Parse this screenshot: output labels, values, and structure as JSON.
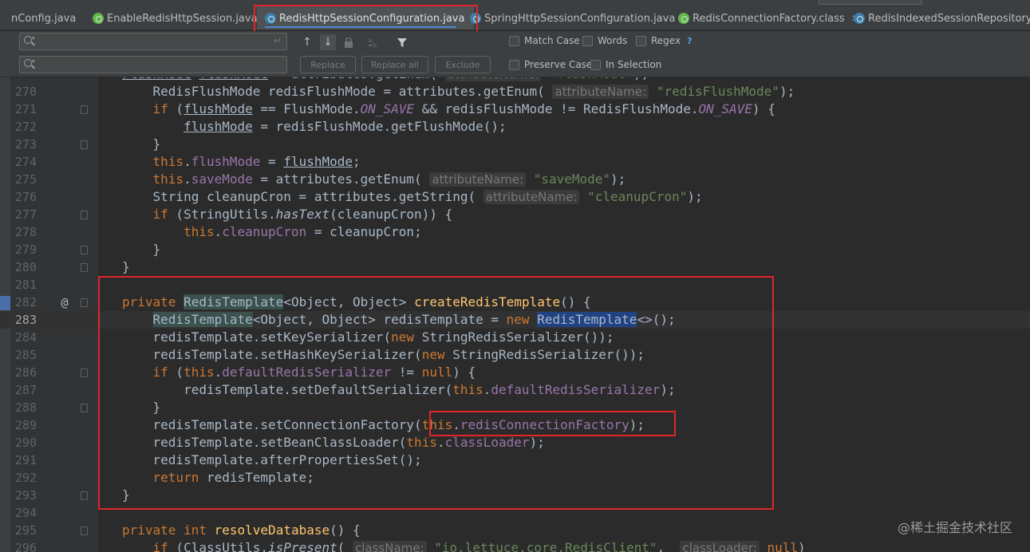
{
  "tabs": [
    {
      "label": "nConfig.java",
      "icon": "class-icon",
      "closable": false
    },
    {
      "label": "EnableRedisHttpSession.java",
      "icon": "annotation-icon",
      "closable": true
    },
    {
      "label": "RedisHttpSessionConfiguration.java",
      "icon": "class-icon",
      "closable": true,
      "active": true
    },
    {
      "label": "SpringHttpSessionConfiguration.java",
      "icon": "class-icon",
      "closable": true
    },
    {
      "label": "RedisConnectionFactory.class",
      "icon": "interface-icon",
      "closable": true
    },
    {
      "label": "RedisIndexedSessionRepository.jav",
      "icon": "class-icon",
      "closable": false
    }
  ],
  "find": {
    "search_value": "",
    "replace_value": "",
    "buttons": {
      "replace": "Replace",
      "replace_all": "Replace all",
      "exclude": "Exclude"
    },
    "options": {
      "match_case": "Match Case",
      "words": "Words",
      "regex": "Regex",
      "regex_help": "?",
      "preserve_case": "Preserve Case",
      "in_selection": "In Selection"
    }
  },
  "editor": {
    "current_line": "283",
    "lines": [
      {
        "num": "270"
      },
      {
        "num": "271"
      },
      {
        "num": "272"
      },
      {
        "num": "273"
      },
      {
        "num": "274"
      },
      {
        "num": "275"
      },
      {
        "num": "276"
      },
      {
        "num": "277"
      },
      {
        "num": "278"
      },
      {
        "num": "279"
      },
      {
        "num": "280"
      },
      {
        "num": "281"
      },
      {
        "num": "282",
        "gutter_mark": "@"
      },
      {
        "num": "283"
      },
      {
        "num": "284"
      },
      {
        "num": "285"
      },
      {
        "num": "286"
      },
      {
        "num": "287"
      },
      {
        "num": "288"
      },
      {
        "num": "289"
      },
      {
        "num": "290"
      },
      {
        "num": "291"
      },
      {
        "num": "292"
      },
      {
        "num": "293"
      },
      {
        "num": "294"
      },
      {
        "num": "295"
      },
      {
        "num": "296"
      }
    ],
    "hints": {
      "attribute_name": "attributeName:",
      "class_name": "className:",
      "class_loader": "classLoader:"
    },
    "strings": {
      "redis_flush_mode": "\"redisFlushMode\"",
      "save_mode": "\"saveMode\"",
      "cleanup_cron": "\"cleanupCron\"",
      "redis_client": "\"io.lettuce.core.RedisClient\""
    }
  },
  "watermark": "@稀土掘金技术社区",
  "colors": {
    "keyword": "#cc7832",
    "string": "#6a8759",
    "field": "#9876aa",
    "method": "#ffc66d",
    "annotation_box": "#e0262b"
  }
}
